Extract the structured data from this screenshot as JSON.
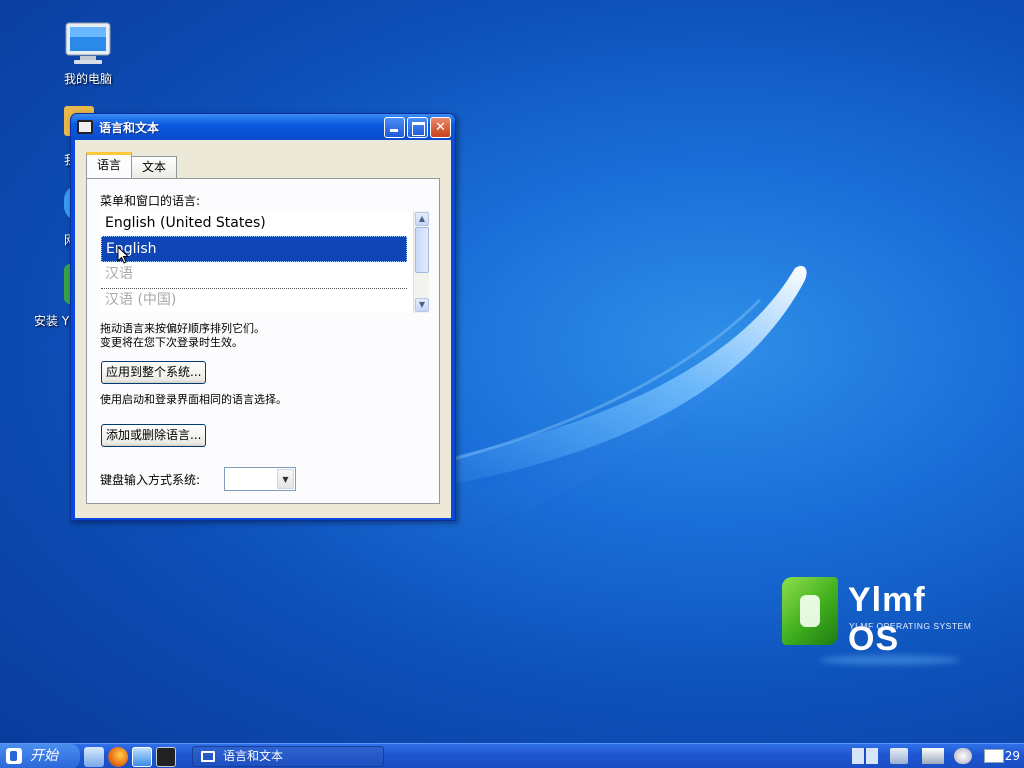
{
  "desktop": {
    "icons": [
      {
        "label": "我的电脑"
      },
      {
        "label": "我"
      },
      {
        "label": "网"
      },
      {
        "label": "安装 Y"
      }
    ],
    "logo": {
      "name": "Ylmf OS",
      "subtitle": "YLMF OPERATING SYSTEM"
    }
  },
  "window": {
    "title": "语言和文本",
    "tabs": [
      {
        "label": "语言",
        "active": true
      },
      {
        "label": "文本",
        "active": false
      }
    ],
    "menu_language_label": "菜单和窗口的语言:",
    "languages": [
      {
        "label": "English (United States)",
        "state": "normal"
      },
      {
        "label": "English",
        "state": "selected"
      },
      {
        "label": "汉语",
        "state": "disabled"
      },
      {
        "label": "汉语 (中国)",
        "state": "disabled"
      }
    ],
    "hint_line1": "拖动语言来按偏好顺序排列它们。",
    "hint_line2": "变更将在您下次登录时生效。",
    "apply_system_button": "应用到整个系统...",
    "apply_system_hint": "使用启动和登录界面相同的语言选择。",
    "add_remove_button": "添加或删除语言...",
    "keyboard_input_label": "键盘输入方式系统:",
    "keyboard_input_value": ""
  },
  "taskbar": {
    "start_label": "开始",
    "tasks": [
      {
        "label": "语言和文本"
      }
    ],
    "clock": "21:29"
  }
}
